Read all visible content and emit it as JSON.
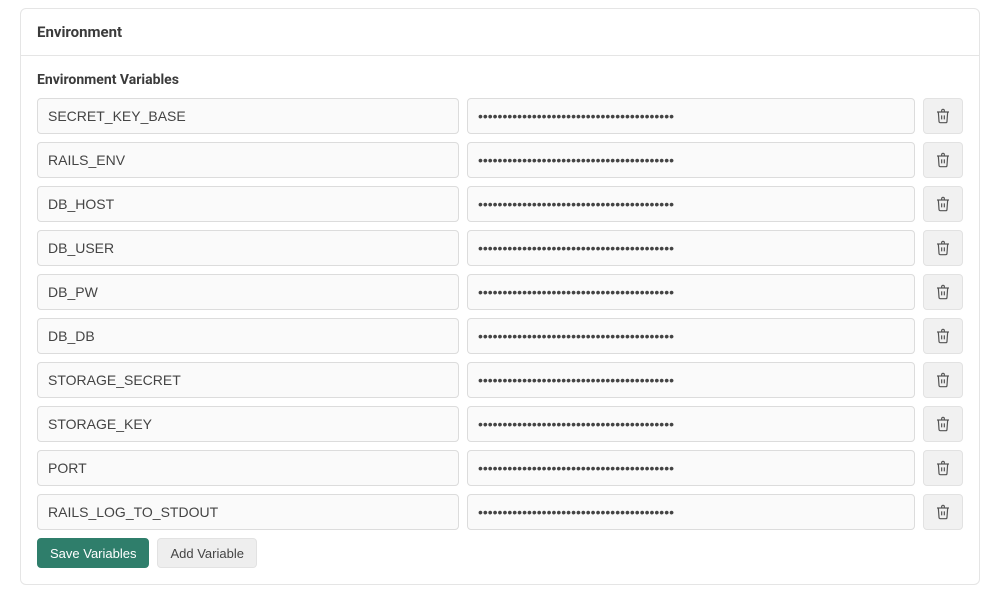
{
  "panel": {
    "title": "Environment",
    "section_title": "Environment Variables"
  },
  "vars": [
    {
      "key": "SECRET_KEY_BASE",
      "value_masked": "••••••••••••••••••••••••••••••••••••••••"
    },
    {
      "key": "RAILS_ENV",
      "value_masked": "••••••••••••••••••••••••••••••••••••••••"
    },
    {
      "key": "DB_HOST",
      "value_masked": "••••••••••••••••••••••••••••••••••••••••"
    },
    {
      "key": "DB_USER",
      "value_masked": "••••••••••••••••••••••••••••••••••••••••"
    },
    {
      "key": "DB_PW",
      "value_masked": "••••••••••••••••••••••••••••••••••••••••"
    },
    {
      "key": "DB_DB",
      "value_masked": "••••••••••••••••••••••••••••••••••••••••"
    },
    {
      "key": "STORAGE_SECRET",
      "value_masked": "••••••••••••••••••••••••••••••••••••••••"
    },
    {
      "key": "STORAGE_KEY",
      "value_masked": "••••••••••••••••••••••••••••••••••••••••"
    },
    {
      "key": "PORT",
      "value_masked": "••••••••••••••••••••••••••••••••••••••••"
    },
    {
      "key": "RAILS_LOG_TO_STDOUT",
      "value_masked": "••••••••••••••••••••••••••••••••••••••••"
    }
  ],
  "buttons": {
    "save": "Save Variables",
    "add": "Add Variable"
  }
}
